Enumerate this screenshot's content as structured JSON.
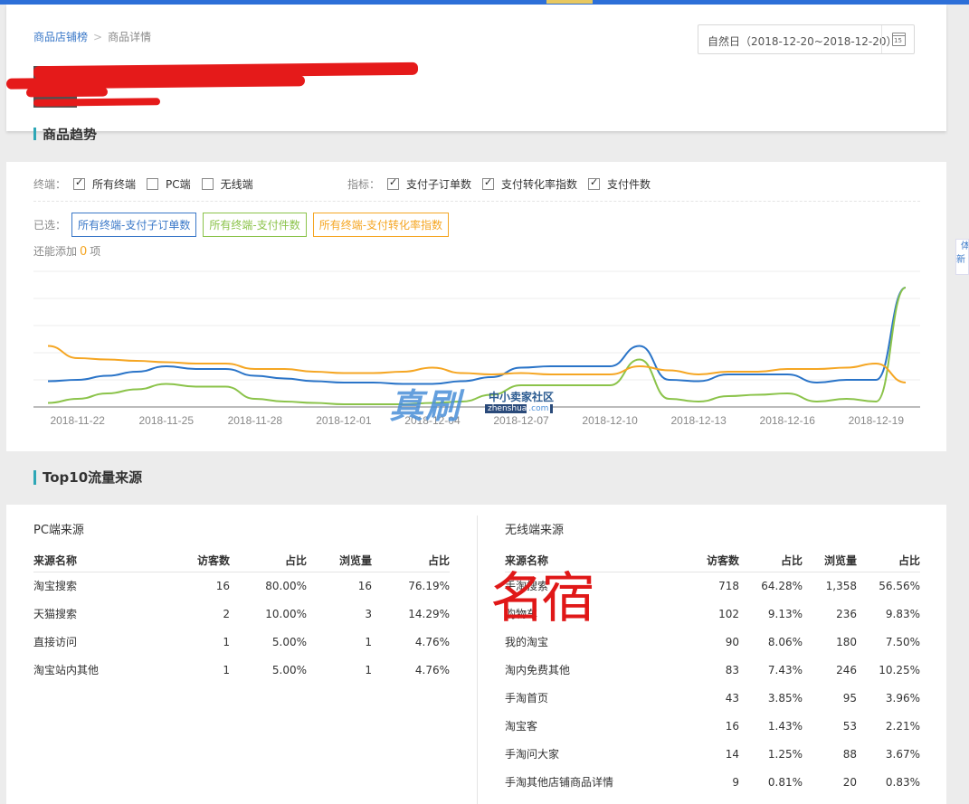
{
  "colors": {
    "accent": "#2d6fd8",
    "blue_series": "#2a74c8",
    "green_series": "#8bc34a",
    "orange_series": "#f5a623",
    "section_bar": "#2ea7b6",
    "redaction": "#e51a1a"
  },
  "breadcrumb": {
    "link": "商品店铺榜",
    "separator": ">",
    "current": "商品详情"
  },
  "date_range": {
    "label": "自然日（2018-12-20~2018-12-20）",
    "calendar_day": "15",
    "icon": "calendar-icon"
  },
  "trend": {
    "title": "商品趋势",
    "terminal_label": "终端：",
    "terminal_options": [
      {
        "label": "所有终端",
        "checked": true
      },
      {
        "label": "PC端",
        "checked": false
      },
      {
        "label": "无线端",
        "checked": false
      }
    ],
    "metric_label": "指标：",
    "metric_options": [
      {
        "label": "支付子订单数",
        "checked": true
      },
      {
        "label": "支付转化率指数",
        "checked": true
      },
      {
        "label": "支付件数",
        "checked": true
      }
    ],
    "selected_label": "已选：",
    "selected_tags": [
      "所有终端-支付子订单数",
      "所有终端-支付件数",
      "所有终端-支付转化率指数"
    ],
    "can_add_prefix": "还能添加",
    "can_add_count": "0",
    "can_add_suffix": "项"
  },
  "chart_data": {
    "type": "line",
    "x": [
      "2018-11-21",
      "2018-11-22",
      "2018-11-23",
      "2018-11-24",
      "2018-11-25",
      "2018-11-26",
      "2018-11-27",
      "2018-11-28",
      "2018-11-29",
      "2018-11-30",
      "2018-12-01",
      "2018-12-02",
      "2018-12-03",
      "2018-12-04",
      "2018-12-05",
      "2018-12-06",
      "2018-12-07",
      "2018-12-08",
      "2018-12-09",
      "2018-12-10",
      "2018-12-11",
      "2018-12-12",
      "2018-12-13",
      "2018-12-14",
      "2018-12-15",
      "2018-12-16",
      "2018-12-17",
      "2018-12-18",
      "2018-12-19",
      "2018-12-20"
    ],
    "tick_labels": [
      "2018-11-22",
      "2018-11-25",
      "2018-11-28",
      "2018-12-01",
      "2018-12-04",
      "2018-12-07",
      "2018-12-10",
      "2018-12-13",
      "2018-12-16",
      "2018-12-19"
    ],
    "ylim": [
      0,
      5
    ],
    "grid": true,
    "y_tick_labels": false,
    "series": [
      {
        "color": "#2a74c8",
        "values": [
          0.95,
          1.0,
          1.15,
          1.3,
          1.5,
          1.4,
          1.4,
          1.15,
          1.05,
          0.95,
          0.9,
          0.9,
          0.85,
          0.85,
          0.95,
          1.1,
          1.45,
          1.5,
          1.5,
          1.5,
          2.25,
          1.0,
          0.95,
          1.2,
          1.2,
          1.2,
          0.9,
          1.0,
          1.0,
          4.4
        ]
      },
      {
        "color": "#8bc34a",
        "values": [
          0.15,
          0.3,
          0.5,
          0.65,
          0.85,
          0.75,
          0.75,
          0.3,
          0.2,
          0.15,
          0.1,
          0.1,
          0.1,
          0.15,
          0.2,
          0.45,
          0.8,
          0.8,
          0.8,
          0.8,
          1.75,
          0.3,
          0.2,
          0.4,
          0.45,
          0.5,
          0.2,
          0.3,
          0.2,
          4.4
        ]
      },
      {
        "color": "#f5a623",
        "values": [
          2.25,
          1.8,
          1.75,
          1.7,
          1.65,
          1.6,
          1.6,
          1.4,
          1.4,
          1.3,
          1.25,
          1.25,
          1.3,
          1.45,
          1.25,
          1.2,
          1.25,
          1.2,
          1.2,
          1.2,
          1.5,
          1.35,
          1.2,
          1.3,
          1.3,
          1.4,
          1.4,
          1.45,
          1.6,
          0.9
        ]
      }
    ]
  },
  "top10": {
    "title": "Top10流量来源",
    "pc": {
      "title": "PC端来源",
      "columns": [
        "来源名称",
        "访客数",
        "占比",
        "浏览量",
        "占比"
      ],
      "rows": [
        [
          "淘宝搜索",
          "16",
          "80.00%",
          "16",
          "76.19%"
        ],
        [
          "天猫搜索",
          "2",
          "10.00%",
          "3",
          "14.29%"
        ],
        [
          "直接访问",
          "1",
          "5.00%",
          "1",
          "4.76%"
        ],
        [
          "淘宝站内其他",
          "1",
          "5.00%",
          "1",
          "4.76%"
        ]
      ]
    },
    "mobile": {
      "title": "无线端来源",
      "columns": [
        "来源名称",
        "访客数",
        "占比",
        "浏览量",
        "占比"
      ],
      "rows": [
        [
          "手淘搜索",
          "718",
          "64.28%",
          "1,358",
          "56.56%"
        ],
        [
          "购物车",
          "102",
          "9.13%",
          "236",
          "9.83%"
        ],
        [
          "我的淘宝",
          "90",
          "8.06%",
          "180",
          "7.50%"
        ],
        [
          "淘内免费其他",
          "83",
          "7.43%",
          "246",
          "10.25%"
        ],
        [
          "手淘首页",
          "43",
          "3.85%",
          "95",
          "3.96%"
        ],
        [
          "淘宝客",
          "16",
          "1.43%",
          "53",
          "2.21%"
        ],
        [
          "手淘问大家",
          "14",
          "1.25%",
          "88",
          "3.67%"
        ],
        [
          "手淘其他店铺商品详情",
          "9",
          "0.81%",
          "20",
          "0.83%"
        ]
      ]
    }
  },
  "side_float": {
    "text": "体新"
  },
  "watermark": {
    "main": "真刷",
    "sub": "中小卖家社区",
    "url": "zhenshua",
    "url_tld": ".com"
  },
  "stamp": {
    "text": "名宿"
  }
}
